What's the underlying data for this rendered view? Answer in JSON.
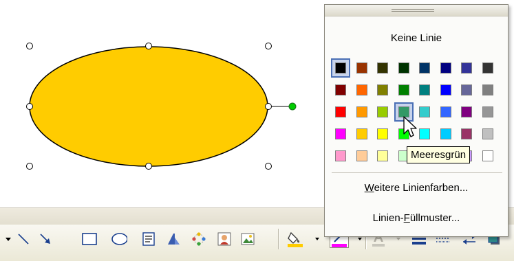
{
  "popup": {
    "no_line_label": "Keine Linie",
    "colors": [
      [
        "#000000",
        "#993300",
        "#333300",
        "#003300",
        "#003366",
        "#000080",
        "#333399",
        "#333333"
      ],
      [
        "#800000",
        "#ff6600",
        "#808000",
        "#008000",
        "#008080",
        "#0000ff",
        "#666699",
        "#808080"
      ],
      [
        "#ff0000",
        "#ff9900",
        "#99cc00",
        "#339966",
        "#33cccc",
        "#3366ff",
        "#800080",
        "#969696"
      ],
      [
        "#ff00ff",
        "#ffcc00",
        "#ffff00",
        "#00ff00",
        "#00ffff",
        "#00ccff",
        "#993366",
        "#c0c0c0"
      ],
      [
        "#ff99cc",
        "#ffcc99",
        "#ffff99",
        "#ccffcc",
        "#ccffff",
        "#99ccff",
        "#cc99ff",
        "#ffffff"
      ]
    ],
    "selected_color": "#000000",
    "hovered_color": "#339966",
    "tooltip": "Meeresgrün",
    "more_colors": {
      "accel": "W",
      "rest": "eitere Linienfarben..."
    },
    "patterns": {
      "pre": "Linien-",
      "accel": "F",
      "post": "üllmuster..."
    }
  },
  "shape": {
    "fill_color": "#ffcc00",
    "rotate_handle_color": "#00cc00"
  },
  "toolbar": {
    "fill_color_bar": "#ffcc00",
    "line_color_bar": "#ff00ff",
    "font_color_bar": "#c8c6bc",
    "icons": [
      "dropdown-arrow-icon",
      "line-icon",
      "arrow-icon",
      "rectangle-icon",
      "oval-icon",
      "textbox-icon",
      "wordart-icon",
      "diagram-icon",
      "clipart-icon",
      "picture-icon",
      "fill-color-icon",
      "line-color-icon",
      "font-color-icon",
      "line-style-icon",
      "dash-style-icon",
      "arrow-style-icon",
      "shadow-icon"
    ]
  }
}
